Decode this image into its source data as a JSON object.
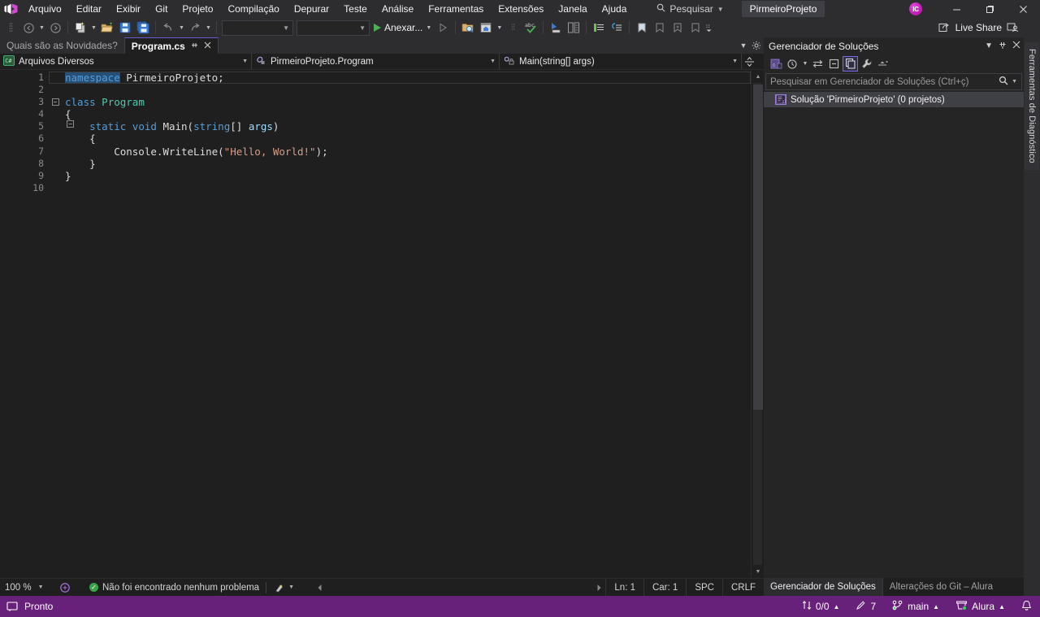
{
  "titlebar": {
    "logo": "visual-studio-logo",
    "menus": [
      "Arquivo",
      "Editar",
      "Exibir",
      "Git",
      "Projeto",
      "Compilação",
      "Depurar",
      "Teste",
      "Análise",
      "Ferramentas",
      "Extensões",
      "Janela",
      "Ajuda"
    ],
    "search_label": "Pesquisar",
    "project_chip": "PirmeiroProjeto",
    "avatar_initials": "IC",
    "window_buttons": {
      "minimize": "—",
      "maximize": "❐",
      "close": "✕"
    }
  },
  "toolbar": {
    "nav_back": "back-icon",
    "nav_forward": "forward-icon",
    "new_item": "new-item-icon",
    "open_file": "open-file-icon",
    "save": "save-icon",
    "save_all": "save-all-icon",
    "undo": "undo-icon",
    "redo": "redo-icon",
    "config_combo": "",
    "platform_combo": "",
    "run_label": "Anexar...",
    "live_share_label": "Live Share"
  },
  "tabs": [
    {
      "label": "Quais são as Novidades?",
      "active": false,
      "closable": false
    },
    {
      "label": "Program.cs",
      "active": true,
      "closable": true,
      "pin": "📌",
      "close": "✕"
    }
  ],
  "navbar": {
    "project": "Arquivos Diversos",
    "project_icon": "csharp-file-icon",
    "type": "PirmeiroProjeto.Program",
    "type_icon": "class-icon",
    "member": "Main(string[] args)",
    "member_icon": "method-private-icon",
    "split_icon": "split-view-icon"
  },
  "editor": {
    "line_numbers": [
      "1",
      "2",
      "3",
      "4",
      "5",
      "6",
      "7",
      "8",
      "9",
      "10"
    ],
    "lines": [
      {
        "n": "1",
        "fold": "",
        "indent": 0,
        "tokens": [
          {
            "t": "namespace",
            "c": "k-blue"
          },
          {
            "t": " ",
            "c": "k-plain"
          },
          {
            "t": "PirmeiroProjeto",
            "c": "k-plain"
          },
          {
            "t": ";",
            "c": "k-plain"
          }
        ],
        "current": true,
        "selection_start": true
      },
      {
        "n": "2",
        "fold": "",
        "indent": 0,
        "tokens": []
      },
      {
        "n": "3",
        "fold": "minus",
        "indent": 0,
        "tokens": [
          {
            "t": "class",
            "c": "k-blue"
          },
          {
            "t": " ",
            "c": "k-plain"
          },
          {
            "t": "Program",
            "c": "k-type"
          }
        ]
      },
      {
        "n": "4",
        "fold": "line",
        "indent": 0,
        "tokens": [
          {
            "t": "{",
            "c": "k-plain"
          }
        ]
      },
      {
        "n": "5",
        "fold": "minus2",
        "indent": 1,
        "tokens": [
          {
            "t": "    static",
            "c": "k-blue"
          },
          {
            "t": " ",
            "c": "k-plain"
          },
          {
            "t": "void",
            "c": "k-blue"
          },
          {
            "t": " ",
            "c": "k-plain"
          },
          {
            "t": "Main",
            "c": "k-meth"
          },
          {
            "t": "(",
            "c": "k-plain"
          },
          {
            "t": "string",
            "c": "k-blue"
          },
          {
            "t": "[] ",
            "c": "k-plain"
          },
          {
            "t": "args",
            "c": "k-par"
          },
          {
            "t": ")",
            "c": "k-plain"
          }
        ]
      },
      {
        "n": "6",
        "fold": "line2",
        "indent": 1,
        "tokens": [
          {
            "t": "    {",
            "c": "k-plain"
          }
        ]
      },
      {
        "n": "7",
        "fold": "line2",
        "indent": 2,
        "tokens": [
          {
            "t": "        Console",
            "c": "k-plain"
          },
          {
            "t": ".",
            "c": "k-plain"
          },
          {
            "t": "WriteLine",
            "c": "k-plain"
          },
          {
            "t": "(",
            "c": "k-plain"
          },
          {
            "t": "\"Hello, World!\"",
            "c": "k-str"
          },
          {
            "t": ")",
            "c": "k-plain"
          },
          {
            "t": ";",
            "c": "k-plain"
          }
        ]
      },
      {
        "n": "8",
        "fold": "line2",
        "indent": 1,
        "tokens": [
          {
            "t": "    }",
            "c": "k-plain"
          }
        ]
      },
      {
        "n": "9",
        "fold": "lineend",
        "indent": 0,
        "tokens": [
          {
            "t": "}",
            "c": "k-plain"
          }
        ]
      },
      {
        "n": "10",
        "fold": "",
        "indent": 0,
        "tokens": []
      }
    ]
  },
  "editor_status": {
    "zoom": "100 %",
    "problems": "Não foi encontrado nenhum problema",
    "line_label": "Ln: 1",
    "col_label": "Car: 1",
    "spaces": "SPC",
    "eol": "CRLF"
  },
  "solution_explorer": {
    "title": "Gerenciador de Soluções",
    "toolbar_icons": [
      "home-icon",
      "pending-changes-icon",
      "sync-icon",
      "collapse-all-icon",
      "properties-icon",
      "wrench-icon",
      "show-all-files-icon"
    ],
    "search_placeholder": "Pesquisar em Gerenciador de Soluções (Ctrl+ç)",
    "nodes": [
      {
        "label": "Solução 'PirmeiroProjeto' (0 projetos)",
        "icon": "solution-icon",
        "selected": true
      }
    ],
    "bottom_tabs": [
      {
        "label": "Gerenciador de Soluções",
        "active": true
      },
      {
        "label": "Alterações do Git – Alura",
        "active": false
      }
    ]
  },
  "right_rail": {
    "vertical_tab": "Ferramentas de Diagnóstico"
  },
  "statusbar": {
    "ready": "Pronto",
    "ready_icon": "notification-icon",
    "sync": "0/0",
    "pending_edits": "7",
    "branch": "main",
    "repo": "Alura",
    "bell_icon": "bell-icon"
  },
  "colors": {
    "accent_purple": "#68217a",
    "tab_accent": "#6a5acd",
    "editor_bg": "#1f1f1f",
    "chrome_bg": "#2d2d30",
    "panel_bg": "#252526",
    "keyword_blue": "#569cd6",
    "type_teal": "#4ec9b0",
    "string_brown": "#d69d85",
    "param_lightblue": "#9cdcfe"
  }
}
